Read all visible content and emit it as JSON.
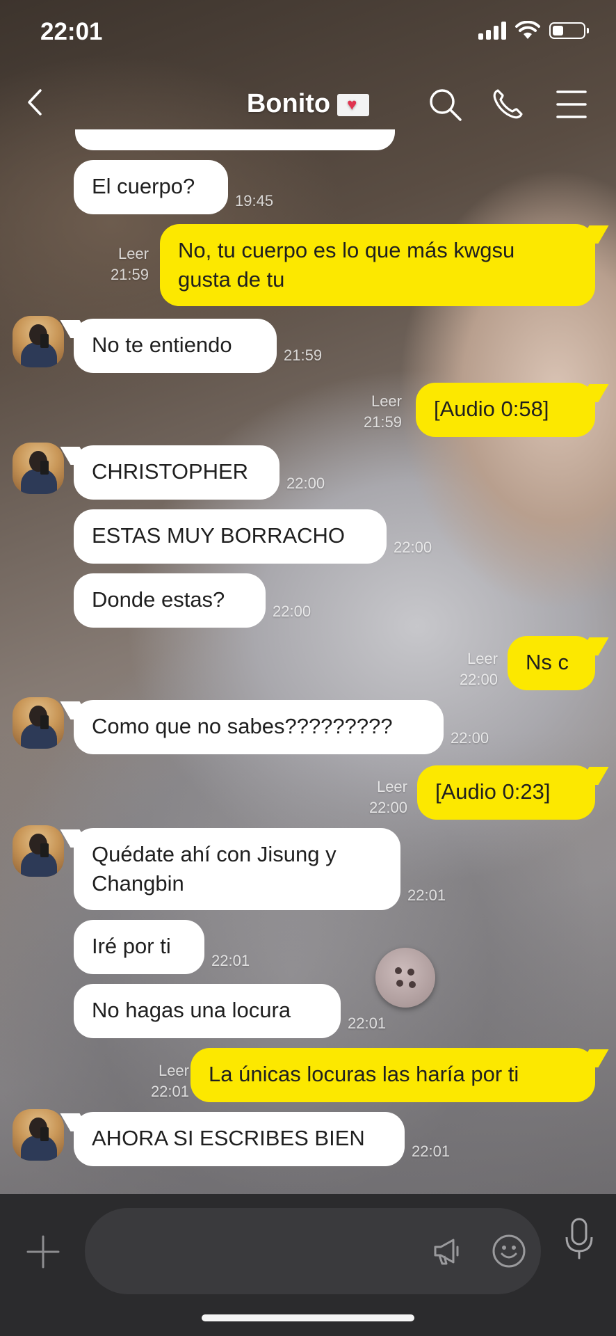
{
  "status_bar": {
    "time": "22:01",
    "battery_level": 0.35
  },
  "header": {
    "title": "Bonito"
  },
  "read_label": "Leer",
  "messages": [
    {
      "side": "in",
      "text": "El cuerpo?",
      "time": "19:45"
    },
    {
      "side": "out",
      "text": "No, tu cuerpo es lo que más kwgsu\ngusta de tu",
      "time": "21:59",
      "read": "Leer"
    },
    {
      "side": "in",
      "text": "No te entiendo",
      "time": "21:59"
    },
    {
      "side": "out",
      "text": "[Audio 0:58]",
      "time": "21:59",
      "read": "Leer"
    },
    {
      "side": "in",
      "text": "CHRISTOPHER",
      "time": "22:00"
    },
    {
      "side": "in",
      "text": "ESTAS MUY BORRACHO",
      "time": "22:00"
    },
    {
      "side": "in",
      "text": "Donde estas?",
      "time": "22:00"
    },
    {
      "side": "out",
      "text": "Ns c",
      "time": "22:00",
      "read": "Leer"
    },
    {
      "side": "in",
      "text": "Como que no sabes?????????",
      "time": "22:00"
    },
    {
      "side": "out",
      "text": "[Audio 0:23]",
      "time": "22:00",
      "read": "Leer"
    },
    {
      "side": "in",
      "text": "Quédate ahí con Jisung y\nChangbin",
      "time": "22:01"
    },
    {
      "side": "in",
      "text": "Iré por ti",
      "time": "22:01"
    },
    {
      "side": "in",
      "text": "No hagas una locura",
      "time": "22:01"
    },
    {
      "side": "out",
      "text": "La únicas locuras las haría por ti",
      "time": "22:01",
      "read": "Leer"
    },
    {
      "side": "in",
      "text": "AHORA SI ESCRIBES BIEN",
      "time": "22:01"
    }
  ],
  "input": {
    "value": "",
    "placeholder": ""
  },
  "icons": {
    "back": "chevron-left-icon",
    "search": "search-icon",
    "call": "phone-icon",
    "menu": "menu-icon",
    "attach": "plus-icon",
    "shout": "megaphone-icon",
    "emoji": "emoji-icon",
    "voice": "microphone-icon"
  },
  "colors": {
    "incoming_bubble": "#ffffff",
    "outgoing_bubble": "#fce800",
    "input_bar": "#2b2b2d"
  }
}
